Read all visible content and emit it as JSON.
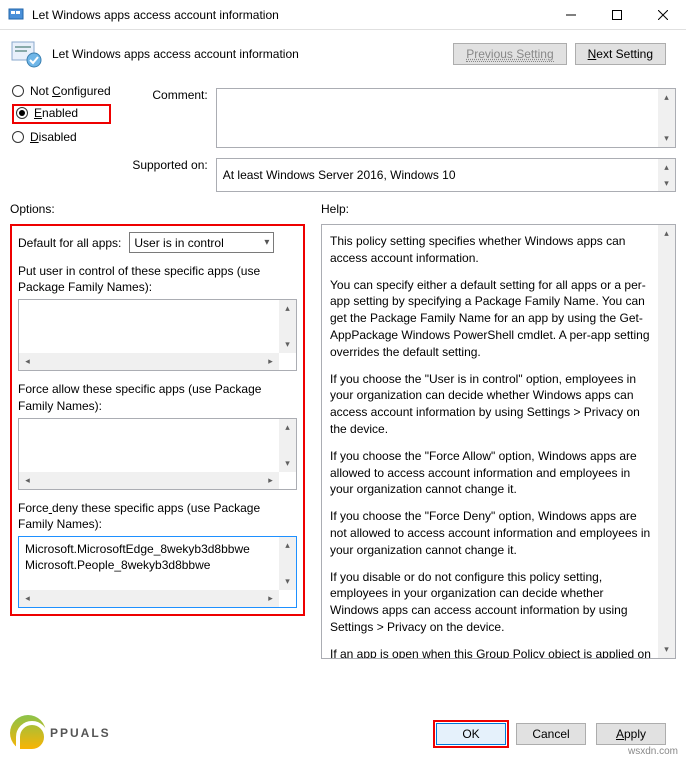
{
  "window": {
    "title": "Let Windows apps access account information",
    "policy_title": "Let Windows apps access account information"
  },
  "nav": {
    "previous": "Previous Setting",
    "next": "Next Setting"
  },
  "radios": {
    "not_configured": "Not Configured",
    "enabled": "Enabled",
    "disabled": "Disabled",
    "selected": "enabled"
  },
  "fields": {
    "comment_label": "Comment:",
    "comment_value": "",
    "supported_label": "Supported on:",
    "supported_value": "At least Windows Server 2016, Windows 10"
  },
  "columns": {
    "options_label": "Options:",
    "help_label": "Help:"
  },
  "options": {
    "default_label": "Default for all apps:",
    "default_value": "User is in control",
    "put_user_label": "Put user in control of these specific apps (use Package Family Names):",
    "put_user_value": "",
    "force_allow_label": "Force allow these specific apps (use Package Family Names):",
    "force_allow_value": "",
    "force_deny_label": "Force deny these specific apps (use Package Family Names):",
    "force_deny_value": "Microsoft.MicrosoftEdge_8wekyb3d8bbwe\nMicrosoft.People_8wekyb3d8bbwe"
  },
  "help": {
    "p1": "This policy setting specifies whether Windows apps can access account information.",
    "p2": "You can specify either a default setting for all apps or a per-app setting by specifying a Package Family Name. You can get the Package Family Name for an app by using the Get-AppPackage Windows PowerShell cmdlet. A per-app setting overrides the default setting.",
    "p3": "If you choose the \"User is in control\" option, employees in your organization can decide whether Windows apps can access account information by using Settings > Privacy on the device.",
    "p4": "If you choose the \"Force Allow\" option, Windows apps are allowed to access account information and employees in your organization cannot change it.",
    "p5": "If you choose the \"Force Deny\" option, Windows apps are not allowed to access account information and employees in your organization cannot change it.",
    "p6": "If you disable or do not configure this policy setting, employees in your organization can decide whether Windows apps can access account information by using Settings > Privacy on the device.",
    "p7": "If an app is open when this Group Policy object is applied on a device, employees must restart the app or device for the policy changes to be applied to the app."
  },
  "footer": {
    "ok": "OK",
    "cancel": "Cancel",
    "apply": "Apply"
  },
  "watermark": {
    "text": "PPUALS",
    "site": "wsxdn.com"
  }
}
